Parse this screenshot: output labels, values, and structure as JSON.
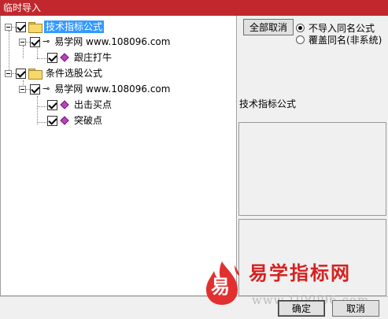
{
  "window": {
    "title": "临时导入"
  },
  "tree": {
    "groups": [
      {
        "label": "技术指标公式",
        "checked": true,
        "selected": true,
        "source": {
          "label": "易学网 www.108096.com",
          "checked": true,
          "items": [
            {
              "label": "跟庄打牛",
              "checked": true
            }
          ]
        }
      },
      {
        "label": "条件选股公式",
        "checked": true,
        "selected": false,
        "source": {
          "label": "易学网 www.108096.com",
          "checked": true,
          "items": [
            {
              "label": "出击买点",
              "checked": true
            },
            {
              "label": "突破点",
              "checked": true
            }
          ]
        }
      }
    ]
  },
  "options": {
    "deselect_all_label": "全部取消",
    "radio": [
      {
        "label": "不导入同名公式",
        "selected": true
      },
      {
        "label": "覆盖同名(非系统)",
        "selected": false
      }
    ]
  },
  "preview": {
    "title": "技术指标公式"
  },
  "footer": {
    "ok_label": "确定",
    "cancel_label": "取消"
  },
  "watermark": {
    "title": "易学指标网",
    "logo_char": "易",
    "url": "www.108096.com"
  },
  "icons": {
    "folder": "folder-icon",
    "source": "key-icon",
    "formula": "diamond-icon",
    "expander": "collapse-box-icon"
  },
  "colors": {
    "titlebar": "#c0282e",
    "selection": "#3399ff",
    "watermark_red": "#d62020"
  }
}
